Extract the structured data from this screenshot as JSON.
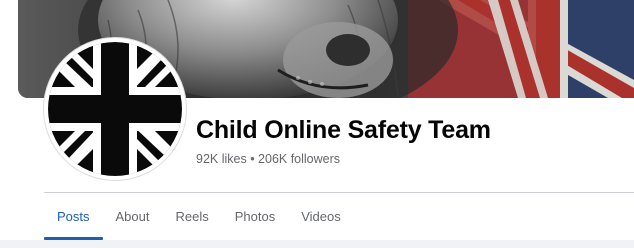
{
  "profile": {
    "name": "Child Online Safety Team",
    "stats": "92K likes • 206K followers"
  },
  "tabs": [
    {
      "label": "Posts",
      "active": true
    },
    {
      "label": "About",
      "active": false
    },
    {
      "label": "Reels",
      "active": false
    },
    {
      "label": "Photos",
      "active": false
    },
    {
      "label": "Videos",
      "active": false
    }
  ],
  "colors": {
    "accent": "#1a5fb4",
    "title": "#050505",
    "muted": "#65676b",
    "flag_red": "#c0392b",
    "flag_blue": "#2c3e6b"
  }
}
